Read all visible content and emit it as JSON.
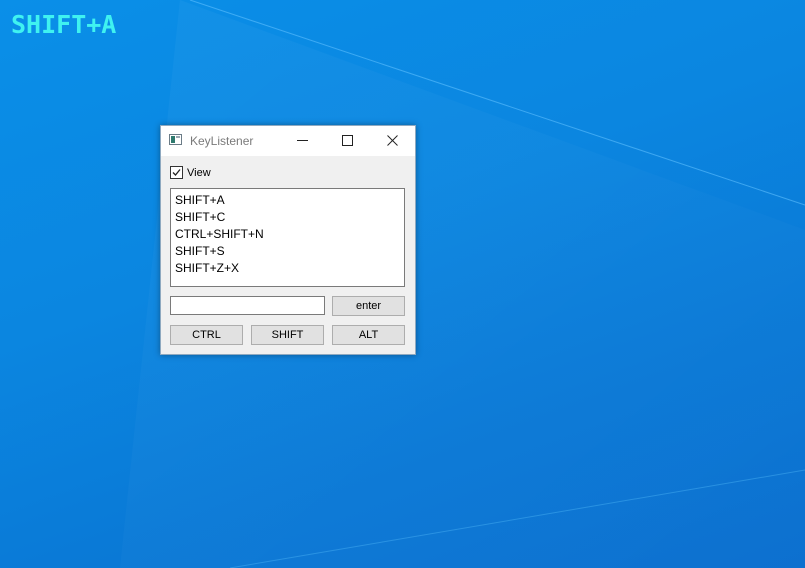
{
  "desktop": {
    "overlay_text": "SHIFT+A",
    "overlay_color": "#3ff2f0"
  },
  "window": {
    "title": "KeyListener",
    "icon": "app-window-icon",
    "controls": {
      "minimize": "minimize-icon",
      "maximize": "maximize-icon",
      "close": "close-icon"
    },
    "view_checkbox": {
      "label": "View",
      "checked": true
    },
    "list_items": [
      "SHIFT+A",
      "SHIFT+C",
      "CTRL+SHIFT+N",
      "SHIFT+S",
      "SHIFT+Z+X"
    ],
    "input": {
      "value": "",
      "placeholder": ""
    },
    "buttons": {
      "enter": "enter",
      "ctrl": "CTRL",
      "shift": "SHIFT",
      "alt": "ALT"
    }
  }
}
